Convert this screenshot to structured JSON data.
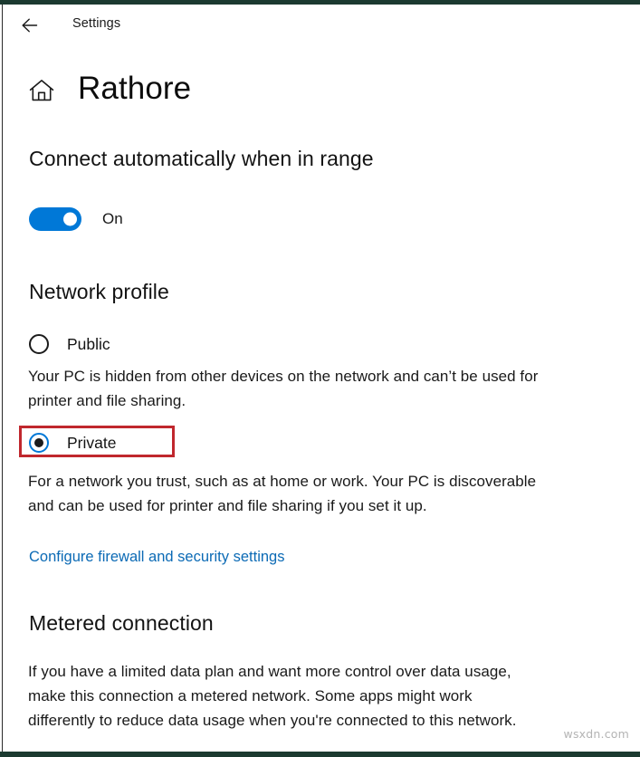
{
  "window": {
    "titlebar_label": "Settings",
    "back_icon": "back-arrow-icon",
    "band_color": "#1b3a30"
  },
  "header": {
    "home_icon": "home-icon",
    "title": "Rathore"
  },
  "connect_automatically": {
    "heading": "Connect automatically when in range",
    "toggle_state_label": "On",
    "toggle_on": true,
    "accent_color": "#0078d7"
  },
  "network_profile": {
    "heading": "Network profile",
    "options": [
      {
        "label": "Public",
        "selected": false,
        "description": "Your PC is hidden from other devices on the network and can’t be used for printer and file sharing."
      },
      {
        "label": "Private",
        "selected": true,
        "description": "For a network you trust, such as at home or work. Your PC is discoverable and can be used for printer and file sharing if you set it up."
      }
    ],
    "link_label": "Configure firewall and security settings",
    "link_color": "#0b6ab5",
    "highlight_color": "#c0272d"
  },
  "metered_connection": {
    "heading": "Metered connection",
    "description": "If you have a limited data plan and want more control over data usage, make this connection a metered network. Some apps might work differently to reduce data usage when you're connected to this network."
  },
  "watermark": {
    "text": "wsxdn.com"
  }
}
